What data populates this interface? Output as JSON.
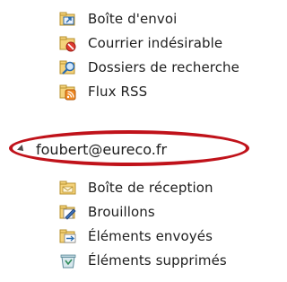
{
  "folders_top": [
    {
      "name": "outbox",
      "label": "Boîte d'envoi",
      "icon": "outbox-icon"
    },
    {
      "name": "junk",
      "label": "Courrier indésirable",
      "icon": "junk-mail-icon"
    },
    {
      "name": "search-folders",
      "label": "Dossiers de recherche",
      "icon": "search-folder-icon"
    },
    {
      "name": "rss",
      "label": "Flux RSS",
      "icon": "rss-icon"
    }
  ],
  "account": {
    "label": "foubert@eureco.fr",
    "expanded": true
  },
  "folders_bottom": [
    {
      "name": "inbox",
      "label": "Boîte de réception",
      "icon": "inbox-icon"
    },
    {
      "name": "drafts",
      "label": "Brouillons",
      "icon": "drafts-icon"
    },
    {
      "name": "sent",
      "label": "Éléments envoyés",
      "icon": "sent-items-icon"
    },
    {
      "name": "deleted",
      "label": "Éléments supprimés",
      "icon": "deleted-items-icon"
    }
  ],
  "colors": {
    "highlight": "#c0121a",
    "folder": "#f2c14e",
    "accent_blue": "#2b6cb0"
  }
}
